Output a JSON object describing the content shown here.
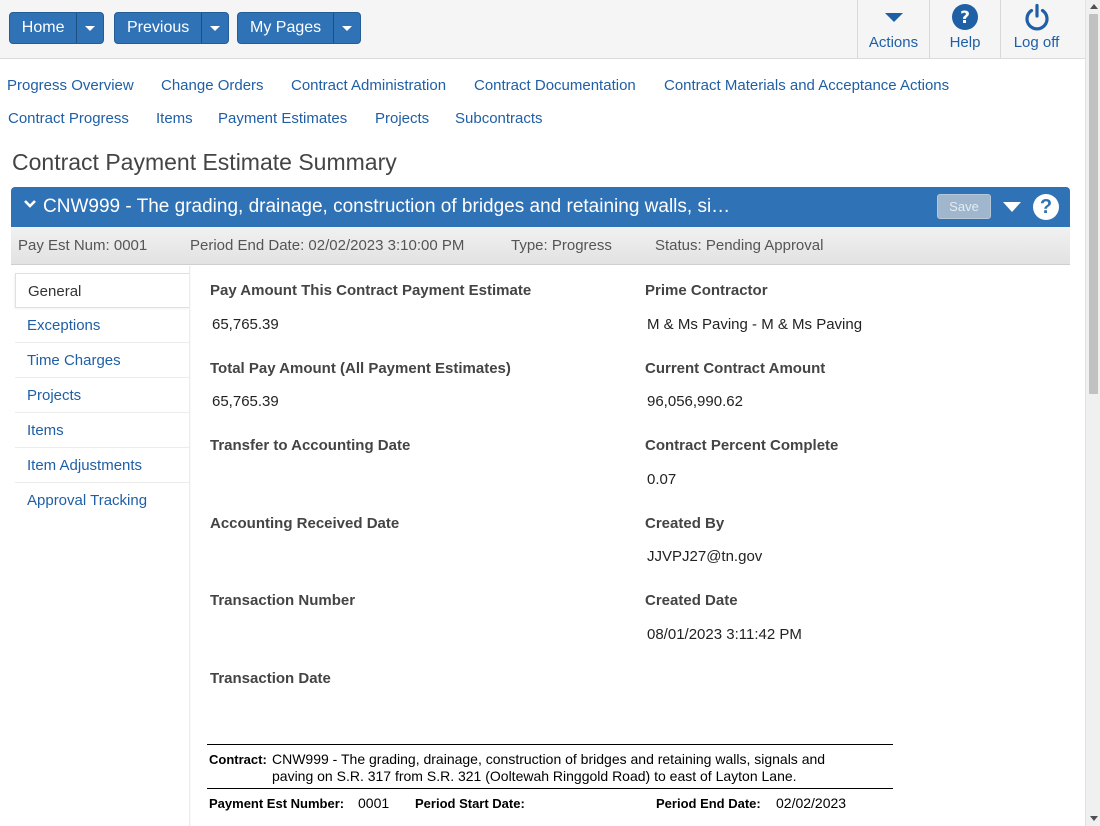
{
  "nav": {
    "home": "Home",
    "previous": "Previous",
    "my_pages": "My Pages",
    "actions": "Actions",
    "help": "Help",
    "log_off": "Log off"
  },
  "links_row1": [
    "Progress Overview",
    "Change Orders",
    "Contract Administration",
    "Contract Documentation",
    "Contract Materials and Acceptance Actions"
  ],
  "links_row2": [
    "Contract Progress",
    "Items",
    "Payment Estimates",
    "Projects",
    "Subcontracts"
  ],
  "page_title": "Contract Payment Estimate Summary",
  "contract_bar": {
    "title": "CNW999 - The grading, drainage, construction of bridges and retaining walls, si…",
    "save": "Save",
    "help": "?"
  },
  "info": {
    "pay_est_num": "Pay Est Num: 0001",
    "period_end": "Period End Date: 02/02/2023 3:10:00 PM",
    "type": "Type: Progress",
    "status": "Status: Pending Approval"
  },
  "tabs": [
    "General",
    "Exceptions",
    "Time Charges",
    "Projects",
    "Items",
    "Item Adjustments",
    "Approval Tracking"
  ],
  "fields": {
    "pay_amount_label": "Pay Amount This Contract Payment Estimate",
    "pay_amount_value": "65,765.39",
    "prime_contractor_label": "Prime Contractor",
    "prime_contractor_value": "M & Ms Paving - M & Ms Paving",
    "total_pay_label": "Total Pay Amount (All Payment Estimates)",
    "total_pay_value": "65,765.39",
    "current_contract_label": "Current Contract Amount",
    "current_contract_value": "96,056,990.62",
    "transfer_label": "Transfer to Accounting Date",
    "percent_complete_label": "Contract Percent Complete",
    "percent_complete_value": "0.07",
    "accounting_received_label": "Accounting Received Date",
    "created_by_label": "Created By",
    "created_by_value": "JJVPJ27@tn.gov",
    "transaction_number_label": "Transaction Number",
    "created_date_label": "Created Date",
    "created_date_value": "08/01/2023 3:11:42 PM",
    "transaction_date_label": "Transaction Date"
  },
  "report": {
    "contract_label": "Contract:",
    "contract_line1": "CNW999 - The grading, drainage, construction of bridges and retaining walls, signals and",
    "contract_line2": "paving on S.R. 317 from S.R. 321 (Ooltewah Ringgold Road) to east of Layton Lane.",
    "pay_est_label": "Payment Est Number:",
    "pay_est_value": "0001",
    "period_start_label": "Period Start Date:",
    "period_end_label": "Period End Date:",
    "period_end_value": "02/02/2023"
  }
}
